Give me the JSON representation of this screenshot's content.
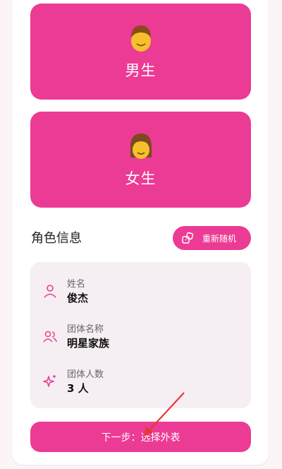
{
  "genders": [
    {
      "label": "男生",
      "icon": "boy-emoji-icon"
    },
    {
      "label": "女生",
      "icon": "girl-emoji-icon"
    }
  ],
  "info": {
    "title": "角色信息",
    "reroll_label": "重新随机",
    "rows": [
      {
        "key": "姓名",
        "value": "俊杰",
        "icon": "person-icon"
      },
      {
        "key": "团体名称",
        "value": "明星家族",
        "icon": "group-icon"
      },
      {
        "key": "团体人数",
        "value": "3 人",
        "icon": "sparkle-icon"
      }
    ]
  },
  "next_label": "下一步：选择外表",
  "colors": {
    "accent": "#ec3b94",
    "panel": "#f5eef2",
    "annotation_arrow": "#e53935"
  }
}
